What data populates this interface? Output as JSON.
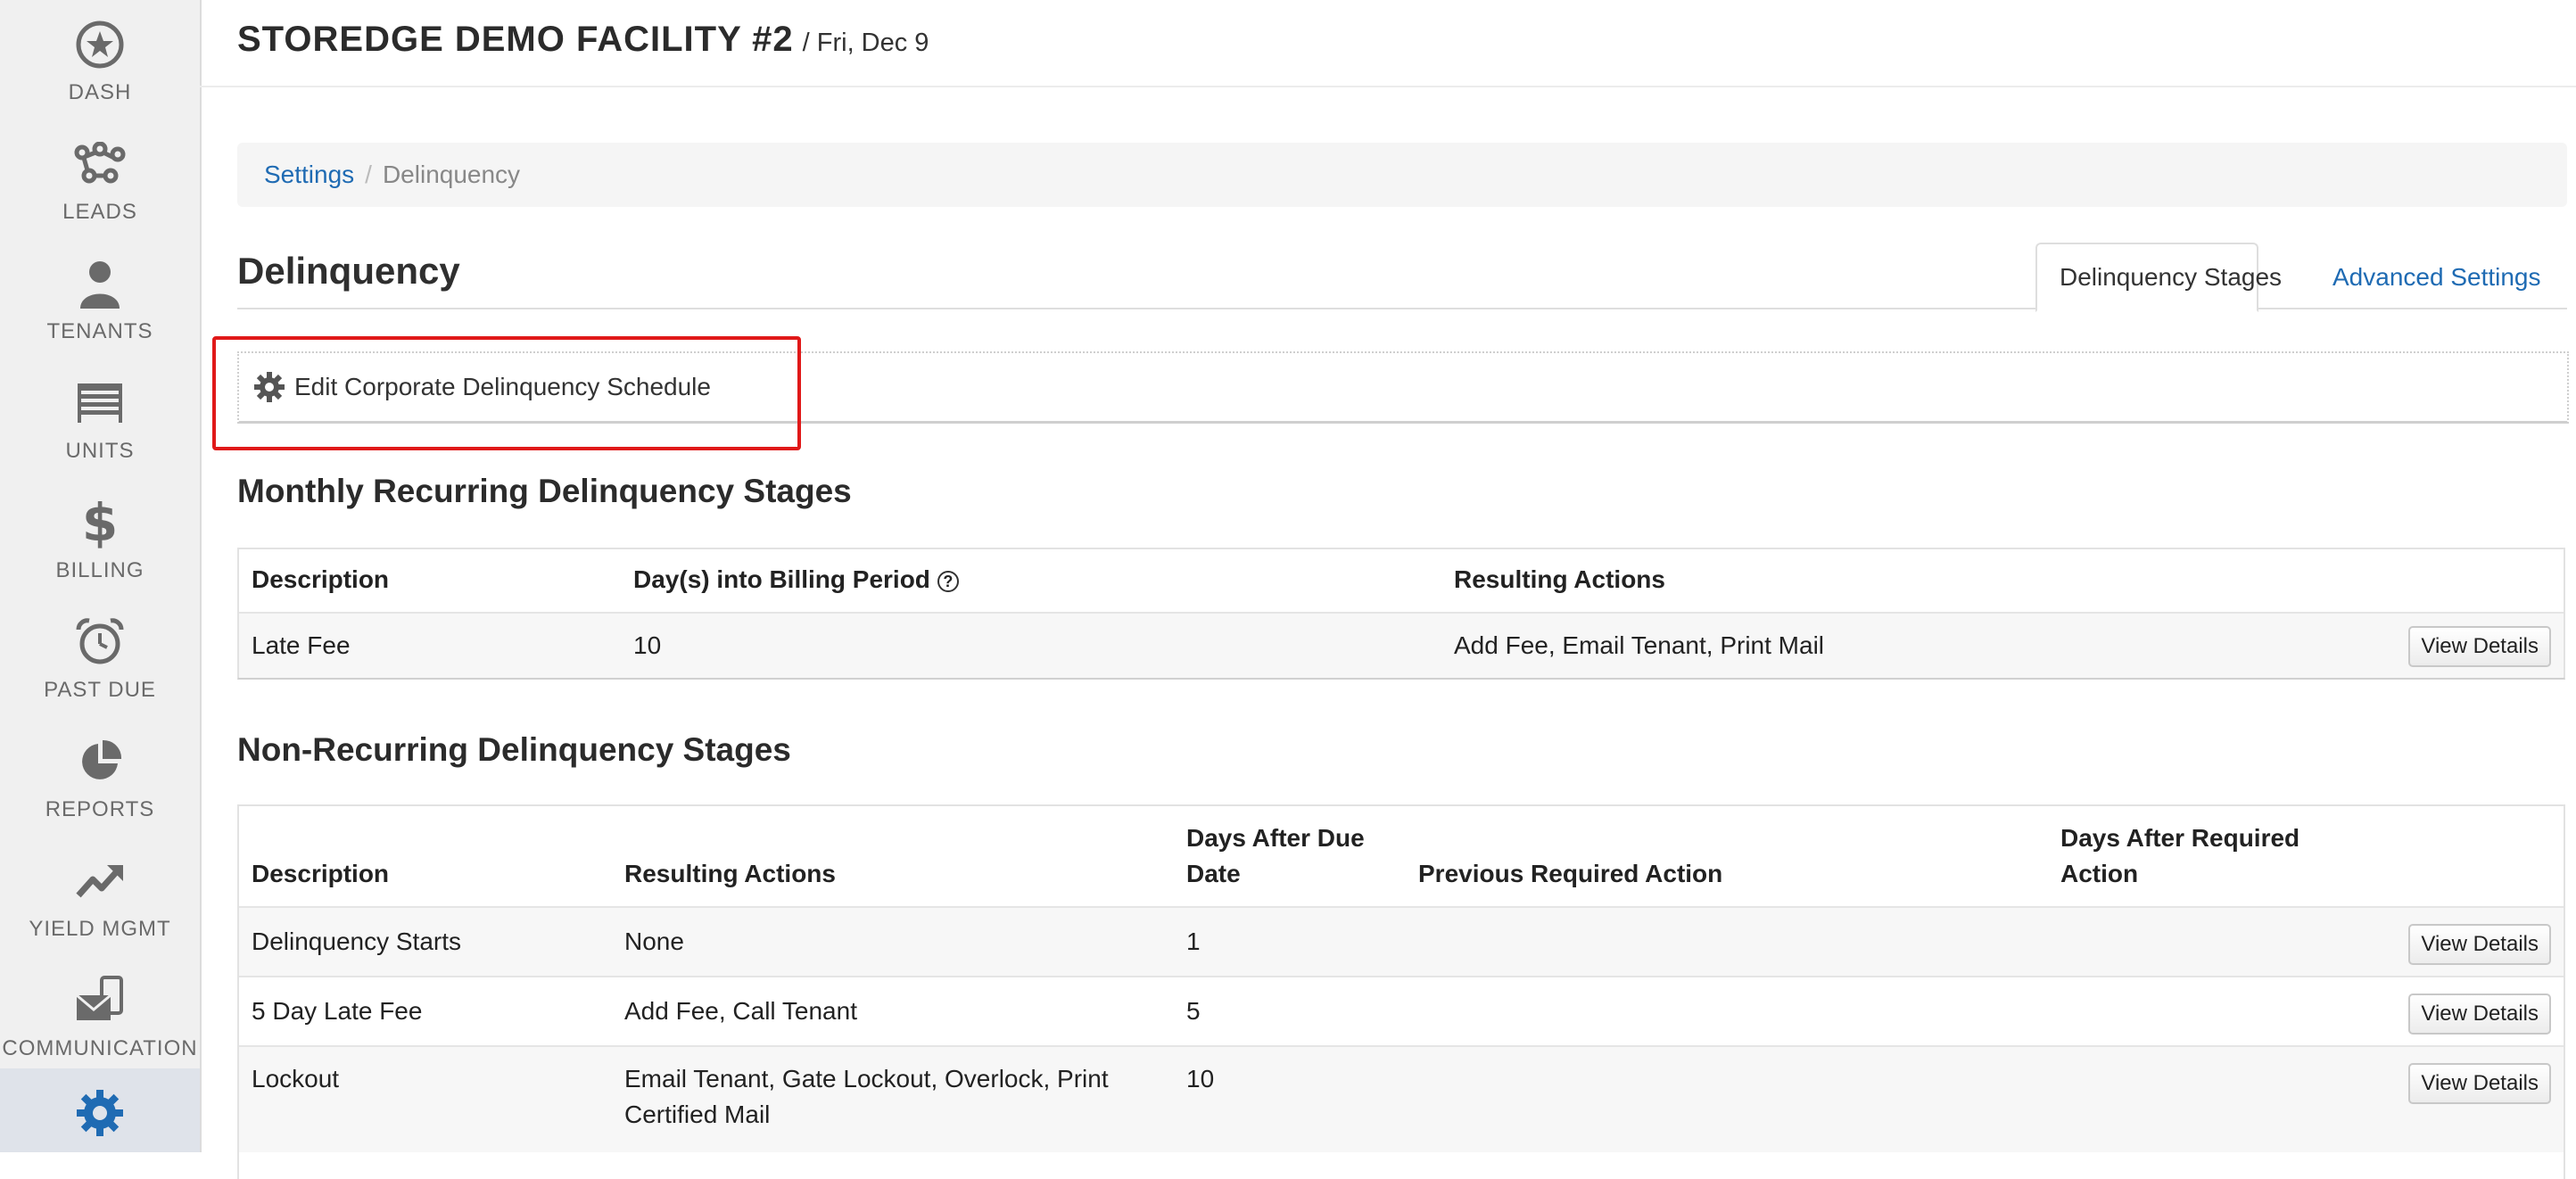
{
  "sidebar": {
    "items": [
      {
        "label": "DASH",
        "icon": "star-circle-icon"
      },
      {
        "label": "LEADS",
        "icon": "network-icon"
      },
      {
        "label": "TENANTS",
        "icon": "person-icon"
      },
      {
        "label": "UNITS",
        "icon": "storage-door-icon"
      },
      {
        "label": "BILLING",
        "icon": "dollar-icon"
      },
      {
        "label": "PAST DUE",
        "icon": "alarm-clock-icon"
      },
      {
        "label": "REPORTS",
        "icon": "pie-chart-icon"
      },
      {
        "label": "YIELD MGMT",
        "icon": "trend-up-icon"
      },
      {
        "label": "COMMUNICATION",
        "icon": "mail-phone-icon"
      },
      {
        "label": "",
        "icon": "gear-icon"
      }
    ],
    "active_color": "#1f6bb3"
  },
  "header": {
    "facility": "STOREDGE DEMO FACILITY #2",
    "date": "/ Fri, Dec 9"
  },
  "breadcrumb": {
    "link": "Settings",
    "separator": "/",
    "current": "Delinquency"
  },
  "page": {
    "title": "Delinquency",
    "tabs": [
      {
        "label": "Delinquency Stages",
        "active": true
      },
      {
        "label": "Advanced Settings",
        "active": false
      }
    ],
    "edit_button": "Edit Corporate Delinquency Schedule"
  },
  "monthly": {
    "title": "Monthly Recurring Delinquency Stages",
    "headers": [
      "Description",
      "Day(s) into Billing Period",
      "Resulting Actions"
    ],
    "help_icon": "?",
    "rows": [
      {
        "description": "Late Fee",
        "days": "10",
        "actions": "Add Fee, Email Tenant, Print Mail",
        "button": "View Details"
      }
    ]
  },
  "nonrecurring": {
    "title": "Non-Recurring Delinquency Stages",
    "headers": {
      "description": "Description",
      "actions": "Resulting Actions",
      "days_after_due_1": "Days After Due",
      "days_after_due_2": "Date",
      "previous": "Previous Required Action",
      "days_after_req_1": "Days After Required",
      "days_after_req_2": "Action"
    },
    "rows": [
      {
        "description": "Delinquency Starts",
        "actions": "None",
        "days": "1",
        "button": "View Details"
      },
      {
        "description": "5 Day Late Fee",
        "actions": "Add Fee, Call Tenant",
        "days": "5",
        "button": "View Details"
      },
      {
        "description": "Lockout",
        "actions_1": "Email Tenant, Gate Lockout, Overlock, Print",
        "actions_2": "Certified Mail",
        "days": "10",
        "button": "View Details"
      }
    ]
  },
  "colors": {
    "link": "#1f6bb3",
    "highlight": "#e01919",
    "sidebar_bg": "#f0f0f0"
  }
}
